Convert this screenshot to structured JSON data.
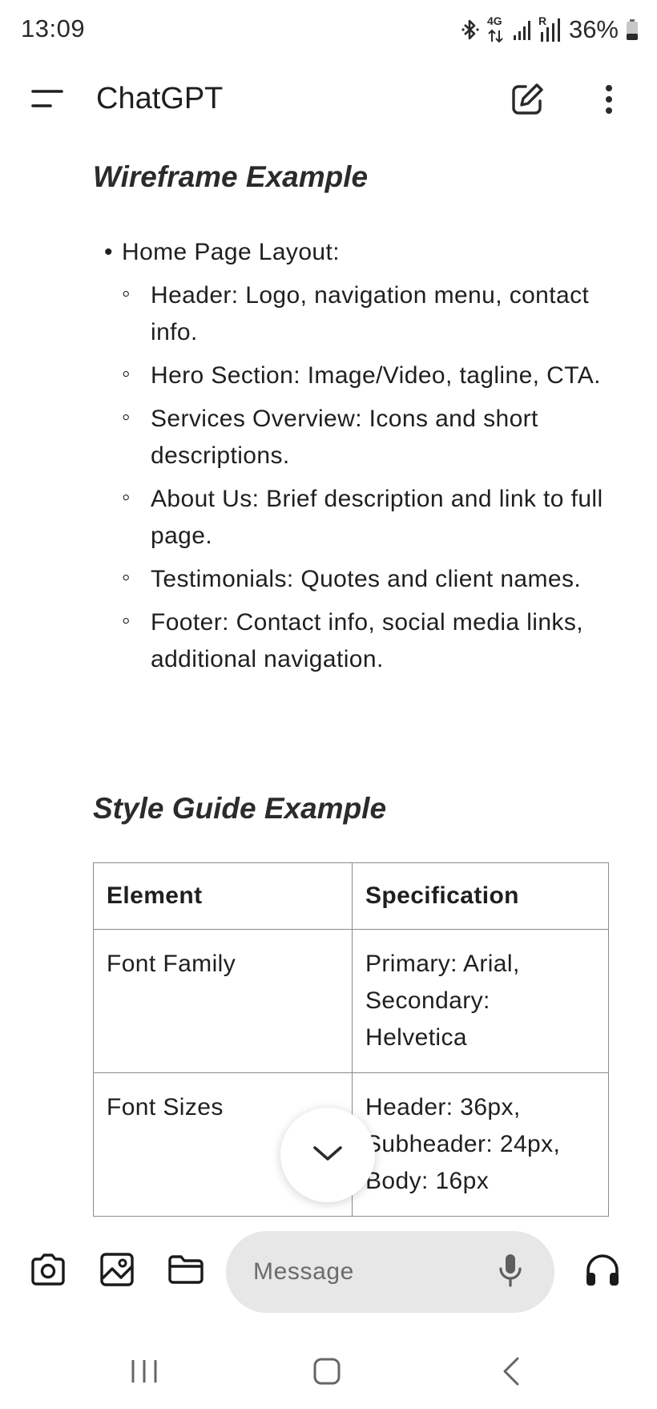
{
  "status_bar": {
    "time": "13:09",
    "network_label": "4G",
    "roaming_label": "R",
    "battery_percent": "36%",
    "battery_level": 0.36,
    "icons": [
      "bluetooth-icon",
      "data-arrows-icon",
      "signal-icon",
      "signal-roaming-icon",
      "battery-icon"
    ]
  },
  "app_bar": {
    "title": "ChatGPT",
    "icons": [
      "menu-icon",
      "new-chat-icon",
      "more-vert-icon"
    ]
  },
  "content": {
    "wireframe_heading": "Wireframe Example",
    "wireframe_list": {
      "label": "Home Page Layout:",
      "items": [
        "Header: Logo, navigation menu, contact info.",
        "Hero Section: Image/Video, tagline, CTA.",
        "Services Overview: Icons and short descriptions.",
        "About Us: Brief description and link to full page.",
        "Testimonials: Quotes and client names.",
        "Footer: Contact info, social media links, additional navigation."
      ]
    },
    "style_guide_heading": "Style Guide Example",
    "table": {
      "headers": [
        "Element",
        "Specification"
      ],
      "rows": [
        [
          "Font Family",
          "Primary: Arial, Secondary: Helvetica"
        ],
        [
          "Font Sizes",
          "Header: 36px, Subheader: 24px, Body: 16px"
        ],
        [
          "",
          ""
        ]
      ]
    }
  },
  "scroll_fab": {
    "icon": "chevron-down-icon"
  },
  "composer": {
    "placeholder": "Message",
    "icons": [
      "camera-icon",
      "image-icon",
      "folder-icon",
      "mic-icon",
      "headphones-icon"
    ]
  },
  "nav_bar": {
    "icons": [
      "recents-icon",
      "home-icon",
      "back-icon"
    ]
  }
}
